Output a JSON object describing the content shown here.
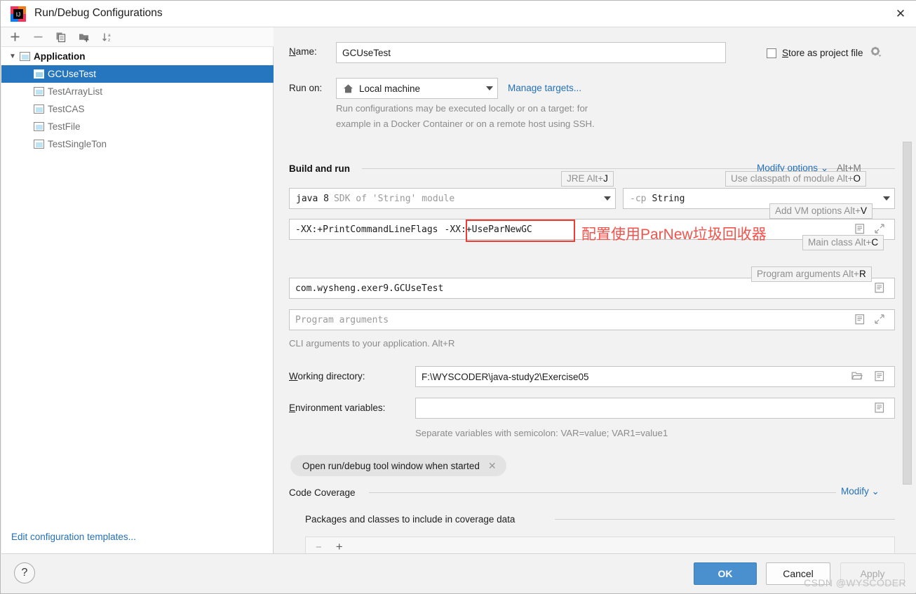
{
  "window": {
    "title": "Run/Debug Configurations",
    "app_icon": "intellij-idea-icon",
    "close_label": "✕"
  },
  "sidebar": {
    "toolbar": [
      {
        "name": "add-configuration-button",
        "glyph": "+"
      },
      {
        "name": "remove-configuration-button",
        "glyph": "−"
      },
      {
        "name": "copy-configuration-button",
        "glyph": "copy"
      },
      {
        "name": "new-folder-button",
        "glyph": "folder-plus"
      },
      {
        "name": "sort-configurations-button",
        "glyph": "sort-az"
      }
    ],
    "group": {
      "label": "Application",
      "expanded": true
    },
    "items": [
      {
        "label": "GCUseTest",
        "selected": true
      },
      {
        "label": "TestArrayList",
        "selected": false
      },
      {
        "label": "TestCAS",
        "selected": false
      },
      {
        "label": "TestFile",
        "selected": false
      },
      {
        "label": "TestSingleTon",
        "selected": false
      }
    ],
    "edit_templates_link": "Edit configuration templates..."
  },
  "form": {
    "name_label": "Name:",
    "name_label_mnemonic": "N",
    "name_value": "GCUseTest",
    "store_as_project_file_label": "Store as project file",
    "store_as_project_file_mnemonic": "S",
    "store_as_project_file_checked": false,
    "store_gear_icon": "gear-icon",
    "run_on_label": "Run on:",
    "run_on_value": "Local machine",
    "run_on_icon": "home-icon",
    "manage_targets_link": "Manage targets...",
    "run_on_description_line1": "Run configurations may be executed locally or on a target: for",
    "run_on_description_line2": "example in a Docker Container or on a remote host using SSH."
  },
  "build_and_run": {
    "section_title": "Build and run",
    "modify_options_link": "Modify options",
    "modify_options_shortcut": "Alt+M",
    "jre_value_bold": "java 8",
    "jre_value_rest": "SDK of 'String' module",
    "classpath_value_prefix": "-cp",
    "classpath_value": "String",
    "vm_options_value": "-XX:+PrintCommandLineFlags",
    "vm_options_highlighted": "-XX:+UseParNewGC",
    "main_class_value": "com.wysheng.exer9.GCUseTest",
    "program_arguments_placeholder": "Program arguments",
    "cli_hint": "CLI arguments to your application. Alt+R",
    "tooltips": [
      {
        "name": "jre-tooltip",
        "text": "JRE Alt+",
        "key": "J"
      },
      {
        "name": "use-classpath-of-module-tooltip",
        "text": "Use classpath of module Alt+",
        "key": "O"
      },
      {
        "name": "add-vm-options-tooltip",
        "text": "Add VM options Alt+",
        "key": "V"
      },
      {
        "name": "main-class-tooltip",
        "text": "Main class Alt+",
        "key": "C"
      },
      {
        "name": "program-arguments-tooltip",
        "text": "Program arguments Alt+",
        "key": "R"
      }
    ]
  },
  "paths": {
    "working_directory_label": "Working directory:",
    "working_directory_mnemonic": "W",
    "working_directory_value": "F:\\WYSCODER\\java-study2\\Exercise05",
    "environment_variables_label": "Environment variables:",
    "environment_variables_mnemonic": "E",
    "environment_variables_value": "",
    "environment_hint": "Separate variables with semicolon: VAR=value; VAR1=value1"
  },
  "options": {
    "open_tool_window_chip": "Open run/debug tool window when started",
    "chip_close_icon": "close-icon"
  },
  "code_coverage": {
    "section_title": "Code Coverage",
    "modify_link": "Modify",
    "packages_title": "Packages and classes to include in coverage data",
    "remove_glyph": "−",
    "add_glyph": "+"
  },
  "annotation": {
    "text": "配置使用ParNew垃圾回收器",
    "color": "#f4524b"
  },
  "footer": {
    "help_label": "?",
    "ok_label": "OK",
    "cancel_label": "Cancel",
    "apply_label": "Apply",
    "watermark": "CSDN @WYSCODER"
  },
  "colors": {
    "accent": "#2675bf",
    "link": "#2470b8",
    "ok_button": "#4a90cf",
    "annotation_red": "#f4524b"
  }
}
